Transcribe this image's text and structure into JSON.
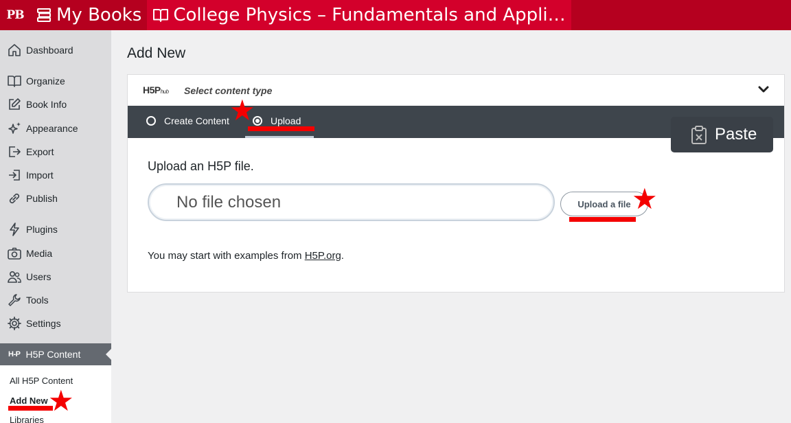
{
  "topbar": {
    "logo": "PB",
    "my_books": "My Books",
    "book_title": "College Physics – Fundamentals and Appli…"
  },
  "sidebar": {
    "items": [
      {
        "label": "Dashboard",
        "icon": "home-icon"
      },
      {
        "label": "Organize",
        "icon": "book-icon"
      },
      {
        "label": "Book Info",
        "icon": "edit-icon"
      },
      {
        "label": "Appearance",
        "icon": "sparkle-icon"
      },
      {
        "label": "Export",
        "icon": "export-icon"
      },
      {
        "label": "Import",
        "icon": "import-icon"
      },
      {
        "label": "Publish",
        "icon": "link-icon"
      },
      {
        "label": "Plugins",
        "icon": "bolt-icon"
      },
      {
        "label": "Media",
        "icon": "camera-icon"
      },
      {
        "label": "Users",
        "icon": "users-icon"
      },
      {
        "label": "Tools",
        "icon": "wrench-icon"
      },
      {
        "label": "Settings",
        "icon": "gear-icon"
      }
    ],
    "h5p_logo": "H-P",
    "h5p_menu": "H5P Content",
    "submenu": [
      "All H5P Content",
      "Add New",
      "Libraries"
    ]
  },
  "main": {
    "title": "Add New",
    "hub_logo": "H5P",
    "hub_logo_sub": "hub",
    "hub_title": "Select content type",
    "tabs": [
      {
        "label": "Create Content",
        "selected": false
      },
      {
        "label": "Upload",
        "selected": true
      }
    ],
    "upload_label": "Upload an H5P file.",
    "file_placeholder": "No file chosen",
    "upload_button": "Upload a file",
    "examples_prefix": "You may start with examples from ",
    "examples_link": "H5P.org",
    "examples_suffix": ".",
    "paste_button": "Paste"
  },
  "colors": {
    "admin_bar": "#b5001f",
    "tab_bar": "#3e454c",
    "annotation": "#f40000"
  }
}
